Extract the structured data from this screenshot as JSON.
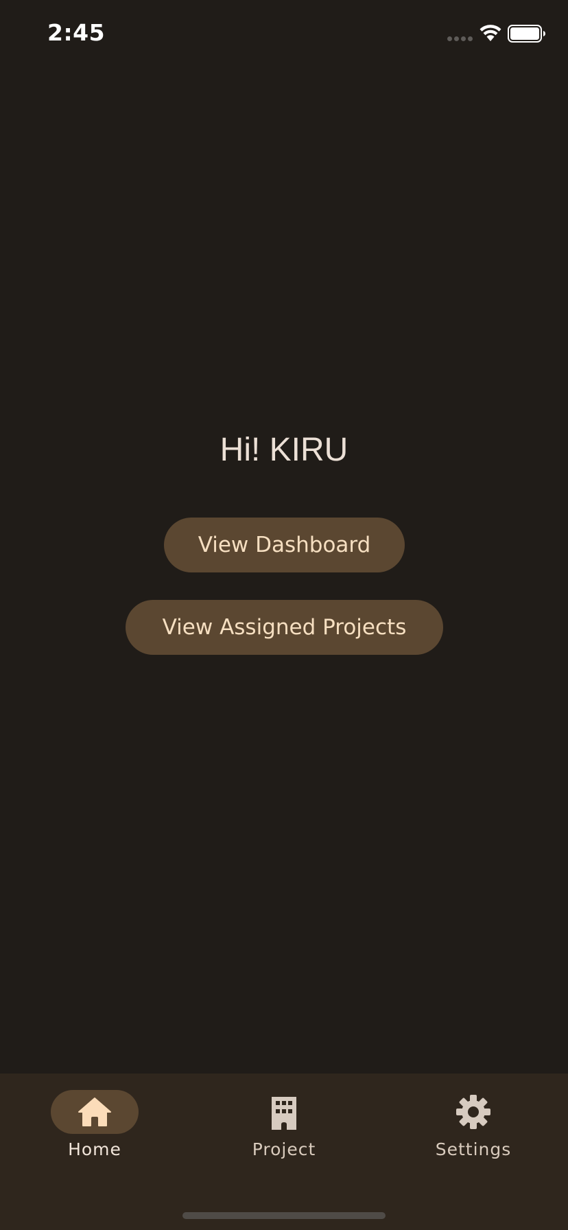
{
  "status_bar": {
    "time": "2:45"
  },
  "main": {
    "greeting": "Hi! KIRU",
    "buttons": [
      {
        "label": "View Dashboard"
      },
      {
        "label": "View Assigned Projects"
      }
    ]
  },
  "bottom_nav": {
    "items": [
      {
        "label": "Home",
        "icon": "home-icon",
        "selected": true
      },
      {
        "label": "Project",
        "icon": "building-icon",
        "selected": false
      },
      {
        "label": "Settings",
        "icon": "gear-icon",
        "selected": false
      }
    ]
  },
  "colors": {
    "background": "#201c18",
    "button_bg": "#5b4731",
    "button_text": "#f6dfc1",
    "nav_bg": "#2f261d"
  }
}
